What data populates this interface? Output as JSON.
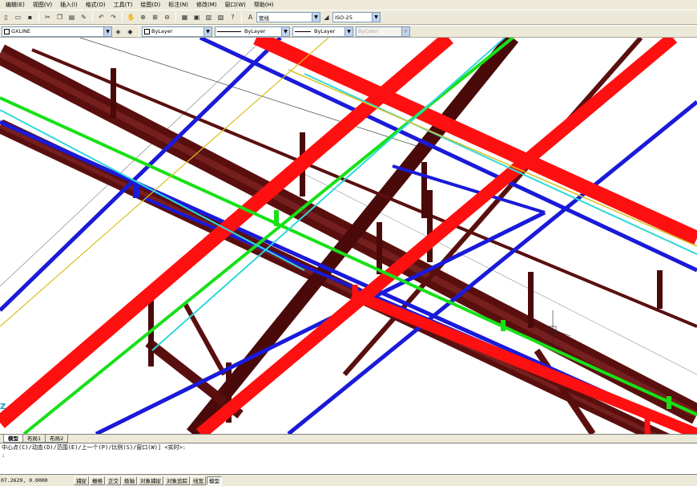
{
  "menu": {
    "items": [
      {
        "label": "编辑(E)"
      },
      {
        "label": "视图(V)"
      },
      {
        "label": "插入(I)"
      },
      {
        "label": "格式(O)"
      },
      {
        "label": "工具(T)"
      },
      {
        "label": "绘图(D)"
      },
      {
        "label": "标注(N)"
      },
      {
        "label": "修改(M)"
      },
      {
        "label": "窗口(W)"
      },
      {
        "label": "帮助(H)"
      }
    ]
  },
  "toolbar": {
    "text_style": "管线",
    "dim_style": "ISO-25"
  },
  "properties": {
    "layer": "GXLINE",
    "color": "ByLayer",
    "linetype": "ByLayer",
    "lineweight": "ByLayer",
    "plotstyle": "ByColor"
  },
  "tabs": [
    {
      "label": "模型",
      "active": true
    },
    {
      "label": "布局1",
      "active": false
    },
    {
      "label": "布局2",
      "active": false
    }
  ],
  "command": {
    "line1": "中心点(C)/动态(D)/范围(E)/上一个(P)/比例(S)/窗口(W)] <实时>:",
    "line2": ":"
  },
  "status": {
    "coords": "07.2629, 0.0000",
    "buttons": [
      {
        "label": "捕捉",
        "on": false
      },
      {
        "label": "栅格",
        "on": false
      },
      {
        "label": "正交",
        "on": false
      },
      {
        "label": "极轴",
        "on": false
      },
      {
        "label": "对象捕捉",
        "on": false
      },
      {
        "label": "对象追踪",
        "on": false
      },
      {
        "label": "线宽",
        "on": false
      },
      {
        "label": "模型",
        "on": true
      }
    ]
  },
  "ucs_label": "Z",
  "colors": {
    "drain": "#5a0f0f",
    "fire": "#ff1010",
    "water": "#1a1ad8",
    "gas": "#18e018",
    "cyan": "#30d8d8",
    "yellow": "#d8c020"
  }
}
